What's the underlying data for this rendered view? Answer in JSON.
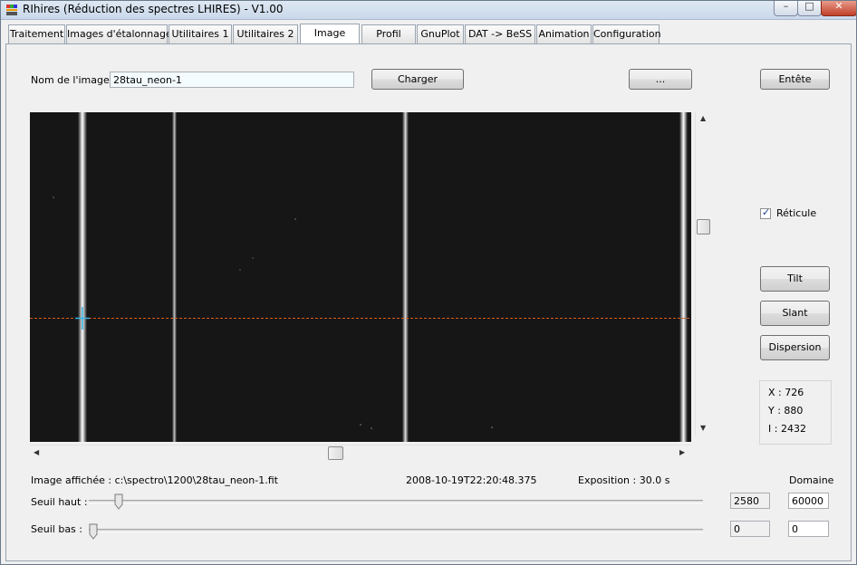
{
  "window": {
    "title": "RIhires (Réduction des spectres LHIRES) - V1.00",
    "minimize": "–",
    "maximize": "□",
    "close": "✕"
  },
  "tabs": [
    "Traitement",
    "Images d'étalonnage",
    "Utilitaires 1",
    "Utilitaires 2",
    "Image",
    "Profil",
    "GnuPlot",
    "DAT -> BeSS",
    "Animation",
    "Configuration"
  ],
  "active_tab": "Image",
  "image_name": {
    "label": "Nom de l'image :",
    "value": "28tau_neon-1"
  },
  "buttons": {
    "load": "Charger",
    "browse": "...",
    "header": "Entête",
    "tilt": "Tilt",
    "slant": "Slant",
    "dispersion": "Dispersion"
  },
  "reticle": {
    "label": "Réticule",
    "checked": true
  },
  "readout": {
    "x": "X : 726",
    "y": "Y : 880",
    "i": "I : 2432"
  },
  "status": {
    "displayed_image": "Image affichée : c:\\spectro\\1200\\28tau_neon-1.fit",
    "datetime": "2008-10-19T22:20:48.375",
    "exposure": "Exposition : 30.0 s"
  },
  "domain_label": "Domaine",
  "thresholds": {
    "high_label": "Seuil haut :",
    "high_value": "2580",
    "high_domain": "60000",
    "low_label": "Seuil bas :",
    "low_value": "0",
    "low_domain": "0"
  },
  "colors": {
    "reticle_line": "#e05a1a",
    "cursor": "#36b6e8",
    "image_bg": "#161616"
  }
}
